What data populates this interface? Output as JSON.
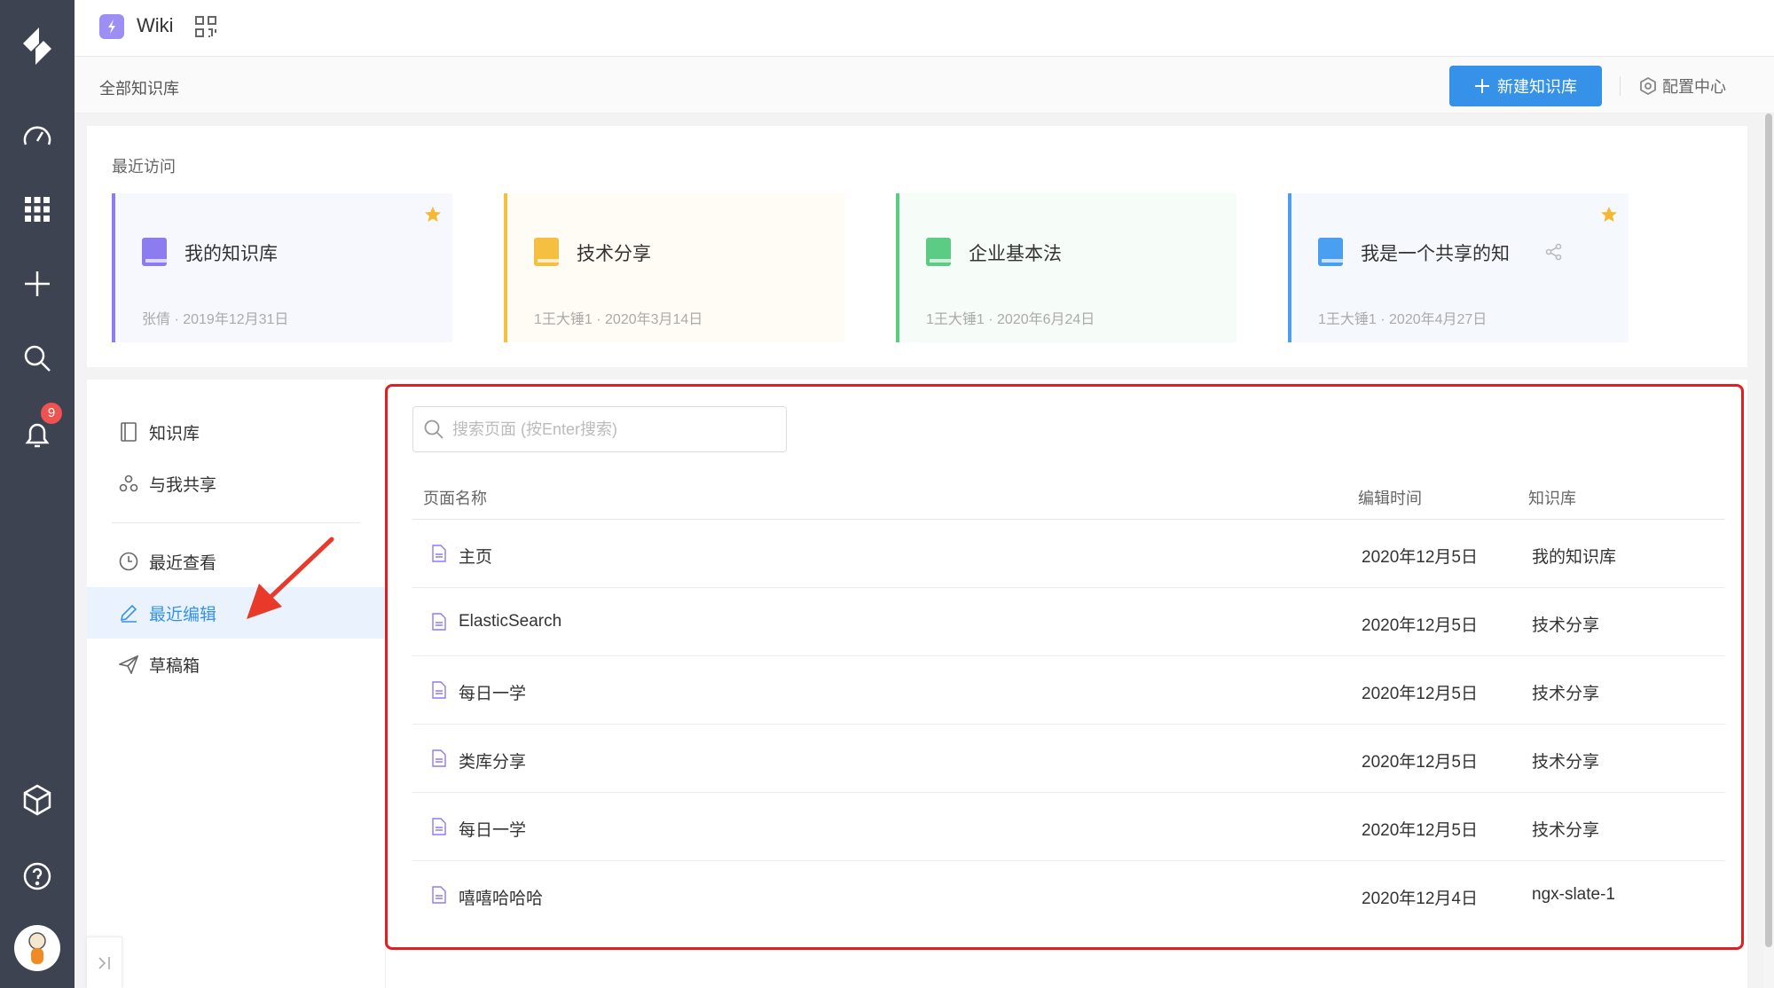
{
  "app": {
    "name": "Wiki"
  },
  "rail": {
    "notification_count": "9"
  },
  "header": {
    "breadcrumb": "全部知识库",
    "new_button": "新建知识库",
    "config_label": "配置中心"
  },
  "recent": {
    "title": "最近访问",
    "cards": [
      {
        "name": "我的知识库",
        "meta": "张倩 · 2019年12月31日",
        "color": "#8b7cf0",
        "bg": "#f7f7fe",
        "starred": true,
        "shared": false
      },
      {
        "name": "技术分享",
        "meta": "1王大锤1 · 2020年3月14日",
        "color": "#f5c042",
        "bg": "#fffcf5",
        "starred": false,
        "shared": false
      },
      {
        "name": "企业基本法",
        "meta": "1王大锤1 · 2020年6月24日",
        "color": "#5ccb83",
        "bg": "#f6fcf8",
        "starred": false,
        "shared": false
      },
      {
        "name": "我是一个共享的知",
        "meta": "1王大锤1 · 2020年4月27日",
        "color": "#4a9ff0",
        "bg": "#f5f9fe",
        "starred": true,
        "shared": true
      }
    ]
  },
  "sidebar": {
    "items": [
      {
        "label": "知识库",
        "icon": "book-icon"
      },
      {
        "label": "与我共享",
        "icon": "share-people-icon"
      },
      {
        "label": "最近查看",
        "icon": "clock-icon"
      },
      {
        "label": "最近编辑",
        "icon": "edit-icon",
        "active": true
      },
      {
        "label": "草稿箱",
        "icon": "paper-plane-icon"
      }
    ]
  },
  "search": {
    "placeholder": "搜索页面 (按Enter搜索)"
  },
  "table": {
    "headers": [
      "页面名称",
      "编辑时间",
      "知识库"
    ],
    "rows": [
      {
        "title": "主页",
        "time": "2020年12月5日",
        "library": "我的知识库"
      },
      {
        "title": "ElasticSearch",
        "time": "2020年12月5日",
        "library": "技术分享"
      },
      {
        "title": "每日一学",
        "time": "2020年12月5日",
        "library": "技术分享"
      },
      {
        "title": "类库分享",
        "time": "2020年12月5日",
        "library": "技术分享"
      },
      {
        "title": "每日一学",
        "time": "2020年12月5日",
        "library": "技术分享"
      },
      {
        "title": "嘻嘻哈哈哈",
        "time": "2020年12月4日",
        "library": "ngx-slate-1"
      }
    ]
  },
  "colors": {
    "accent": "#3592e8",
    "rail": "#3d4351",
    "highlight": "#e02020"
  }
}
